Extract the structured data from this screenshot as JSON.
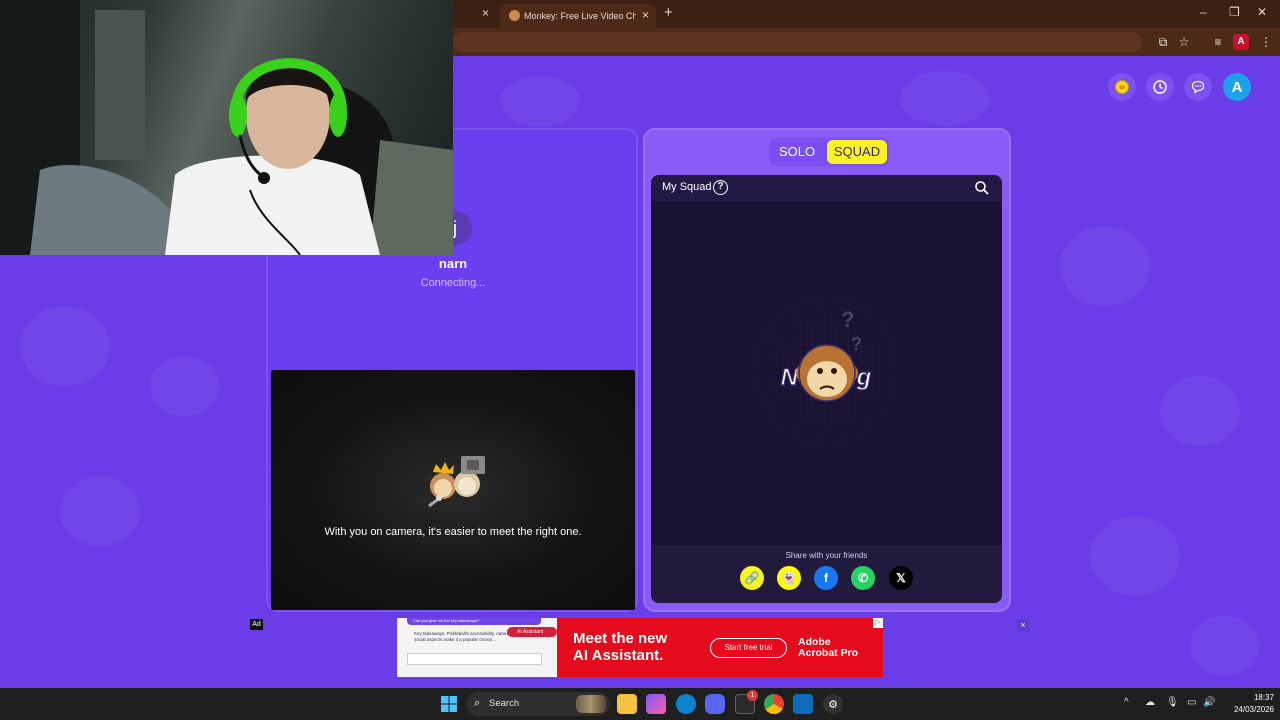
{
  "browser": {
    "active_tab_title": "Monkey: Free Live Video Chat w",
    "tab_close_glyph": "×",
    "new_tab_glyph": "+",
    "window_controls": [
      "–",
      "❐",
      "✕"
    ]
  },
  "topbar": {
    "history_icon": "clock-icon",
    "chat_icon": "chat-icon",
    "avatar_letter": "A"
  },
  "left_panel": {
    "peer_initial": "j",
    "peer_name": "narn",
    "peer_status": "Connecting...",
    "camera_message": "With you on camera, it's easier to meet the right one."
  },
  "right_panel": {
    "mode_tabs": [
      "SOLO",
      "SQUAD"
    ],
    "selected_mode": "SQUAD",
    "squad_title": "My Squad",
    "help_glyph": "?",
    "empty_state_text": "Nothing",
    "share_label": "Share with your friends",
    "share_buttons": [
      {
        "name": "link",
        "glyph": "🔗",
        "color": "#f7f325"
      },
      {
        "name": "snapchat",
        "glyph": "👻",
        "color": "#fffc00"
      },
      {
        "name": "facebook",
        "glyph": "f",
        "color": "#1877f2"
      },
      {
        "name": "whatsapp",
        "glyph": "✆",
        "color": "#25d366"
      },
      {
        "name": "x",
        "glyph": "𝕏",
        "color": "#000000"
      }
    ]
  },
  "ad": {
    "badge": "Ad",
    "chat_question": "Can you give me the key takeaways?",
    "chat_answer": "Key takeaways: Pickleball's accessibility, nature, and social aspects make it a popular choice...",
    "assistant_chip": "AI Assistant",
    "headline_line1": "Meet the new",
    "headline_line2": "AI Assistant.",
    "cta": "Start free trial",
    "brand_line1": "Adobe",
    "brand_line2": "Acrobat Pro",
    "choices_glyph": "▷",
    "close_glyph": "×"
  },
  "taskbar": {
    "search_label": "Search",
    "notification_count": "1",
    "time": "18:37",
    "date": "24/03/2026",
    "tray_icons": [
      "^",
      "☁",
      "🎙",
      "▭",
      "🔊"
    ]
  },
  "colors": {
    "page_bg": "#6a3de8",
    "accent_yellow": "#f7f325",
    "ad_red": "#e50b1c"
  }
}
